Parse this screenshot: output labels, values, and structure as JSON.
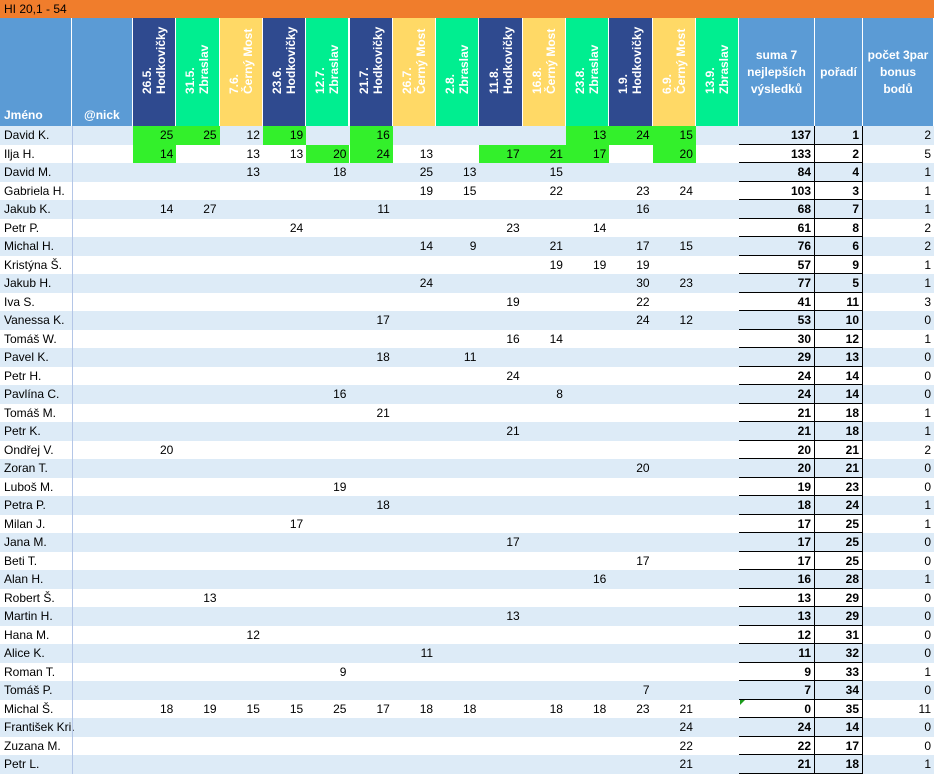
{
  "title": "HI 20,1 - 54",
  "headers": {
    "name": "Jméno",
    "nick": "@nick",
    "sum": "suma 7 nejlepších výsledků",
    "rank": "pořadí",
    "bonus": "počet 3par bonus bodů"
  },
  "events": [
    {
      "date": "26.5.",
      "place": "Hodkovičky",
      "color": "#2f4a8f",
      "text": "#ffffff"
    },
    {
      "date": "31.5.",
      "place": "Zbraslav",
      "color": "#00ee90",
      "text": "#ffffff"
    },
    {
      "date": "7.6.",
      "place": "Černý Most",
      "color": "#ffd966",
      "text": "#ffffff"
    },
    {
      "date": "23.6.",
      "place": "Hodkovičky",
      "color": "#2f4a8f",
      "text": "#ffffff"
    },
    {
      "date": "12.7.",
      "place": "Zbraslav",
      "color": "#00ee90",
      "text": "#ffffff"
    },
    {
      "date": "21.7.",
      "place": "Hodkovičky",
      "color": "#2f4a8f",
      "text": "#ffffff"
    },
    {
      "date": "26.7.",
      "place": "Černý Most",
      "color": "#ffd966",
      "text": "#ffffff"
    },
    {
      "date": "2.8.",
      "place": "Zbraslav",
      "color": "#00ee90",
      "text": "#ffffff"
    },
    {
      "date": "11.8.",
      "place": "Hodkovičky",
      "color": "#2f4a8f",
      "text": "#ffffff"
    },
    {
      "date": "16.8.",
      "place": "Černý Most",
      "color": "#ffd966",
      "text": "#ffffff"
    },
    {
      "date": "23.8.",
      "place": "Zbraslav",
      "color": "#00ee90",
      "text": "#ffffff"
    },
    {
      "date": "1.9.",
      "place": "Hodkovičky",
      "color": "#2f4a8f",
      "text": "#ffffff"
    },
    {
      "date": "6.9.",
      "place": "Černý Most",
      "color": "#ffd966",
      "text": "#ffffff"
    },
    {
      "date": "13.9.",
      "place": "Zbraslav",
      "color": "#00ee90",
      "text": "#ffffff"
    }
  ],
  "highlight_color": "#33f02b",
  "rows": [
    {
      "name": "David K.",
      "scores": [
        "25",
        "25",
        "12",
        "19",
        "",
        "16",
        "",
        "",
        "",
        "",
        "13",
        "24",
        "15",
        ""
      ],
      "hl": [
        0,
        1,
        3,
        5,
        10,
        11,
        12
      ],
      "sum": "137",
      "rank": "1",
      "bonus": "2"
    },
    {
      "name": "Ilja H.",
      "scores": [
        "14",
        "",
        "13",
        "13",
        "20",
        "24",
        "13",
        "",
        "17",
        "21",
        "17",
        "",
        "20",
        ""
      ],
      "hl": [
        0,
        4,
        5,
        8,
        9,
        10,
        12
      ],
      "sum": "133",
      "rank": "2",
      "bonus": "5"
    },
    {
      "name": "David M.",
      "scores": [
        "",
        "",
        "13",
        "",
        "18",
        "",
        "25",
        "13",
        "",
        "15",
        "",
        "",
        "",
        ""
      ],
      "hl": [],
      "sum": "84",
      "rank": "4",
      "bonus": "1"
    },
    {
      "name": "Gabriela H.",
      "scores": [
        "",
        "",
        "",
        "",
        "",
        "",
        "19",
        "15",
        "",
        "22",
        "",
        "23",
        "24",
        ""
      ],
      "hl": [],
      "sum": "103",
      "rank": "3",
      "bonus": "1"
    },
    {
      "name": "Jakub K.",
      "scores": [
        "14",
        "27",
        "",
        "",
        "",
        "11",
        "",
        "",
        "",
        "",
        "",
        "16",
        "",
        ""
      ],
      "hl": [],
      "sum": "68",
      "rank": "7",
      "bonus": "1"
    },
    {
      "name": "Petr P.",
      "scores": [
        "",
        "",
        "",
        "24",
        "",
        "",
        "",
        "",
        "23",
        "",
        "14",
        "",
        "",
        ""
      ],
      "hl": [],
      "sum": "61",
      "rank": "8",
      "bonus": "2"
    },
    {
      "name": "Michal H.",
      "scores": [
        "",
        "",
        "",
        "",
        "",
        "",
        "14",
        "9",
        "",
        "21",
        "",
        "17",
        "15",
        ""
      ],
      "hl": [],
      "sum": "76",
      "rank": "6",
      "bonus": "2"
    },
    {
      "name": "Kristýna Š.",
      "scores": [
        "",
        "",
        "",
        "",
        "",
        "",
        "",
        "",
        "",
        "19",
        "19",
        "19",
        "",
        ""
      ],
      "hl": [],
      "sum": "57",
      "rank": "9",
      "bonus": "1"
    },
    {
      "name": "Jakub H.",
      "scores": [
        "",
        "",
        "",
        "",
        "",
        "",
        "24",
        "",
        "",
        "",
        "",
        "30",
        "23",
        ""
      ],
      "hl": [],
      "sum": "77",
      "rank": "5",
      "bonus": "1"
    },
    {
      "name": "Iva S.",
      "scores": [
        "",
        "",
        "",
        "",
        "",
        "",
        "",
        "",
        "19",
        "",
        "",
        "22",
        "",
        ""
      ],
      "hl": [],
      "sum": "41",
      "rank": "11",
      "bonus": "3"
    },
    {
      "name": "Vanessa K.",
      "scores": [
        "",
        "",
        "",
        "",
        "",
        "17",
        "",
        "",
        "",
        "",
        "",
        "24",
        "12",
        ""
      ],
      "hl": [],
      "sum": "53",
      "rank": "10",
      "bonus": "0"
    },
    {
      "name": "Tomáš W.",
      "scores": [
        "",
        "",
        "",
        "",
        "",
        "",
        "",
        "",
        "16",
        "14",
        "",
        "",
        "",
        ""
      ],
      "hl": [],
      "sum": "30",
      "rank": "12",
      "bonus": "1"
    },
    {
      "name": "Pavel K.",
      "scores": [
        "",
        "",
        "",
        "",
        "",
        "18",
        "",
        "11",
        "",
        "",
        "",
        "",
        "",
        ""
      ],
      "hl": [],
      "sum": "29",
      "rank": "13",
      "bonus": "0"
    },
    {
      "name": "Petr H.",
      "scores": [
        "",
        "",
        "",
        "",
        "",
        "",
        "",
        "",
        "24",
        "",
        "",
        "",
        "",
        ""
      ],
      "hl": [],
      "sum": "24",
      "rank": "14",
      "bonus": "0"
    },
    {
      "name": "Pavlína C.",
      "scores": [
        "",
        "",
        "",
        "",
        "16",
        "",
        "",
        "",
        "",
        "8",
        "",
        "",
        "",
        ""
      ],
      "hl": [],
      "sum": "24",
      "rank": "14",
      "bonus": "0"
    },
    {
      "name": "Tomáš M.",
      "scores": [
        "",
        "",
        "",
        "",
        "",
        "21",
        "",
        "",
        "",
        "",
        "",
        "",
        "",
        ""
      ],
      "hl": [],
      "sum": "21",
      "rank": "18",
      "bonus": "1"
    },
    {
      "name": "Petr K.",
      "scores": [
        "",
        "",
        "",
        "",
        "",
        "",
        "",
        "",
        "21",
        "",
        "",
        "",
        "",
        ""
      ],
      "hl": [],
      "sum": "21",
      "rank": "18",
      "bonus": "1"
    },
    {
      "name": "Ondřej V.",
      "scores": [
        "20",
        "",
        "",
        "",
        "",
        "",
        "",
        "",
        "",
        "",
        "",
        "",
        "",
        ""
      ],
      "hl": [],
      "sum": "20",
      "rank": "21",
      "bonus": "2"
    },
    {
      "name": "Zoran T.",
      "scores": [
        "",
        "",
        "",
        "",
        "",
        "",
        "",
        "",
        "",
        "",
        "",
        "20",
        "",
        ""
      ],
      "hl": [],
      "sum": "20",
      "rank": "21",
      "bonus": "0"
    },
    {
      "name": "Luboš M.",
      "scores": [
        "",
        "",
        "",
        "",
        "19",
        "",
        "",
        "",
        "",
        "",
        "",
        "",
        "",
        ""
      ],
      "hl": [],
      "sum": "19",
      "rank": "23",
      "bonus": "0"
    },
    {
      "name": "Petra P.",
      "scores": [
        "",
        "",
        "",
        "",
        "",
        "18",
        "",
        "",
        "",
        "",
        "",
        "",
        "",
        ""
      ],
      "hl": [],
      "sum": "18",
      "rank": "24",
      "bonus": "1"
    },
    {
      "name": "Milan J.",
      "scores": [
        "",
        "",
        "",
        "17",
        "",
        "",
        "",
        "",
        "",
        "",
        "",
        "",
        "",
        ""
      ],
      "hl": [],
      "sum": "17",
      "rank": "25",
      "bonus": "1"
    },
    {
      "name": "Jana M.",
      "scores": [
        "",
        "",
        "",
        "",
        "",
        "",
        "",
        "",
        "17",
        "",
        "",
        "",
        "",
        ""
      ],
      "hl": [],
      "sum": "17",
      "rank": "25",
      "bonus": "0"
    },
    {
      "name": "Beti T.",
      "scores": [
        "",
        "",
        "",
        "",
        "",
        "",
        "",
        "",
        "",
        "",
        "",
        "17",
        "",
        ""
      ],
      "hl": [],
      "sum": "17",
      "rank": "25",
      "bonus": "0"
    },
    {
      "name": "Alan H.",
      "scores": [
        "",
        "",
        "",
        "",
        "",
        "",
        "",
        "",
        "",
        "",
        "16",
        "",
        "",
        ""
      ],
      "hl": [],
      "sum": "16",
      "rank": "28",
      "bonus": "1"
    },
    {
      "name": "Robert Š.",
      "scores": [
        "",
        "13",
        "",
        "",
        "",
        "",
        "",
        "",
        "",
        "",
        "",
        "",
        "",
        ""
      ],
      "hl": [],
      "sum": "13",
      "rank": "29",
      "bonus": "0"
    },
    {
      "name": "Martin H.",
      "scores": [
        "",
        "",
        "",
        "",
        "",
        "",
        "",
        "",
        "13",
        "",
        "",
        "",
        "",
        ""
      ],
      "hl": [],
      "sum": "13",
      "rank": "29",
      "bonus": "0"
    },
    {
      "name": "Hana M.",
      "scores": [
        "",
        "",
        "12",
        "",
        "",
        "",
        "",
        "",
        "",
        "",
        "",
        "",
        "",
        ""
      ],
      "hl": [],
      "sum": "12",
      "rank": "31",
      "bonus": "0"
    },
    {
      "name": "Alice K.",
      "scores": [
        "",
        "",
        "",
        "",
        "",
        "",
        "11",
        "",
        "",
        "",
        "",
        "",
        "",
        ""
      ],
      "hl": [],
      "sum": "11",
      "rank": "32",
      "bonus": "0"
    },
    {
      "name": "Roman T.",
      "scores": [
        "",
        "",
        "",
        "",
        "9",
        "",
        "",
        "",
        "",
        "",
        "",
        "",
        "",
        ""
      ],
      "hl": [],
      "sum": "9",
      "rank": "33",
      "bonus": "1"
    },
    {
      "name": "Tomáš P.",
      "scores": [
        "",
        "",
        "",
        "",
        "",
        "",
        "",
        "",
        "",
        "",
        "",
        "7",
        "",
        ""
      ],
      "hl": [],
      "sum": "7",
      "rank": "34",
      "bonus": "0"
    },
    {
      "name": "Michal Š.",
      "scores": [
        "18",
        "19",
        "15",
        "15",
        "25",
        "17",
        "18",
        "18",
        "",
        "18",
        "18",
        "23",
        "21",
        ""
      ],
      "hl": [],
      "sum": "0",
      "rank": "35",
      "bonus": "11",
      "note": true
    },
    {
      "name": "František Kri.",
      "scores": [
        "",
        "",
        "",
        "",
        "",
        "",
        "",
        "",
        "",
        "",
        "",
        "",
        "24",
        ""
      ],
      "hl": [],
      "sum": "24",
      "rank": "14",
      "bonus": "0"
    },
    {
      "name": "Zuzana M.",
      "scores": [
        "",
        "",
        "",
        "",
        "",
        "",
        "",
        "",
        "",
        "",
        "",
        "",
        "22",
        ""
      ],
      "hl": [],
      "sum": "22",
      "rank": "17",
      "bonus": "0"
    },
    {
      "name": "Petr L.",
      "scores": [
        "",
        "",
        "",
        "",
        "",
        "",
        "",
        "",
        "",
        "",
        "",
        "",
        "21",
        ""
      ],
      "hl": [],
      "sum": "21",
      "rank": "18",
      "bonus": "1"
    }
  ]
}
